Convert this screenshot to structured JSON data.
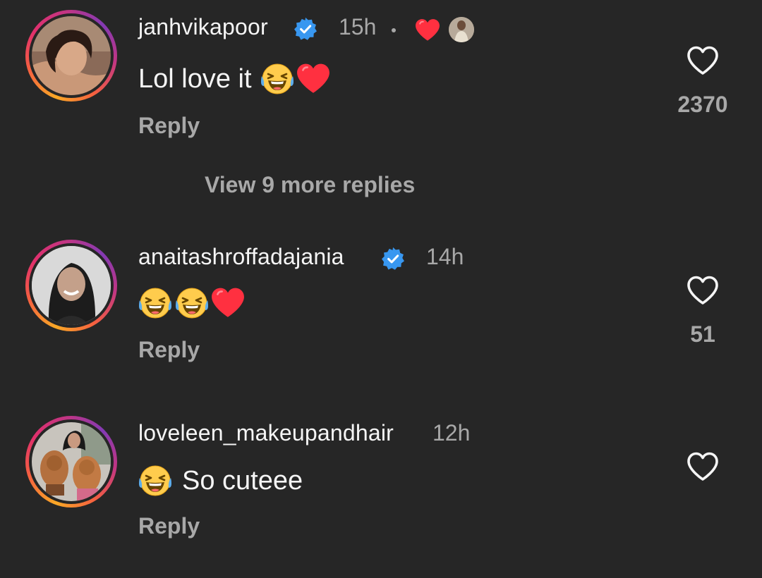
{
  "comments": [
    {
      "username": "janhvikapoor",
      "verified": true,
      "time": "15h",
      "author_liked": true,
      "text": "Lol love it",
      "emojis": [
        "laughing-tears",
        "red-heart"
      ],
      "reply_label": "Reply",
      "like_count": "2370"
    },
    {
      "username": "anaitashroffadajania",
      "verified": true,
      "time": "14h",
      "text": "",
      "emojis": [
        "laughing-tears",
        "laughing-tears",
        "red-heart"
      ],
      "reply_label": "Reply",
      "like_count": "51"
    },
    {
      "username": "loveleen_makeupandhair",
      "verified": false,
      "time": "12h",
      "text": "So cuteee",
      "emojis": [
        "laughing-tears"
      ],
      "reply_label": "Reply",
      "like_count": ""
    }
  ],
  "view_more_replies": "View 9 more replies",
  "colors": {
    "background": "#262626",
    "primary_text": "#f5f5f5",
    "secondary_text": "#a8a8a8",
    "verified_blue": "#3897f0",
    "heart_red": "#ff3040"
  }
}
